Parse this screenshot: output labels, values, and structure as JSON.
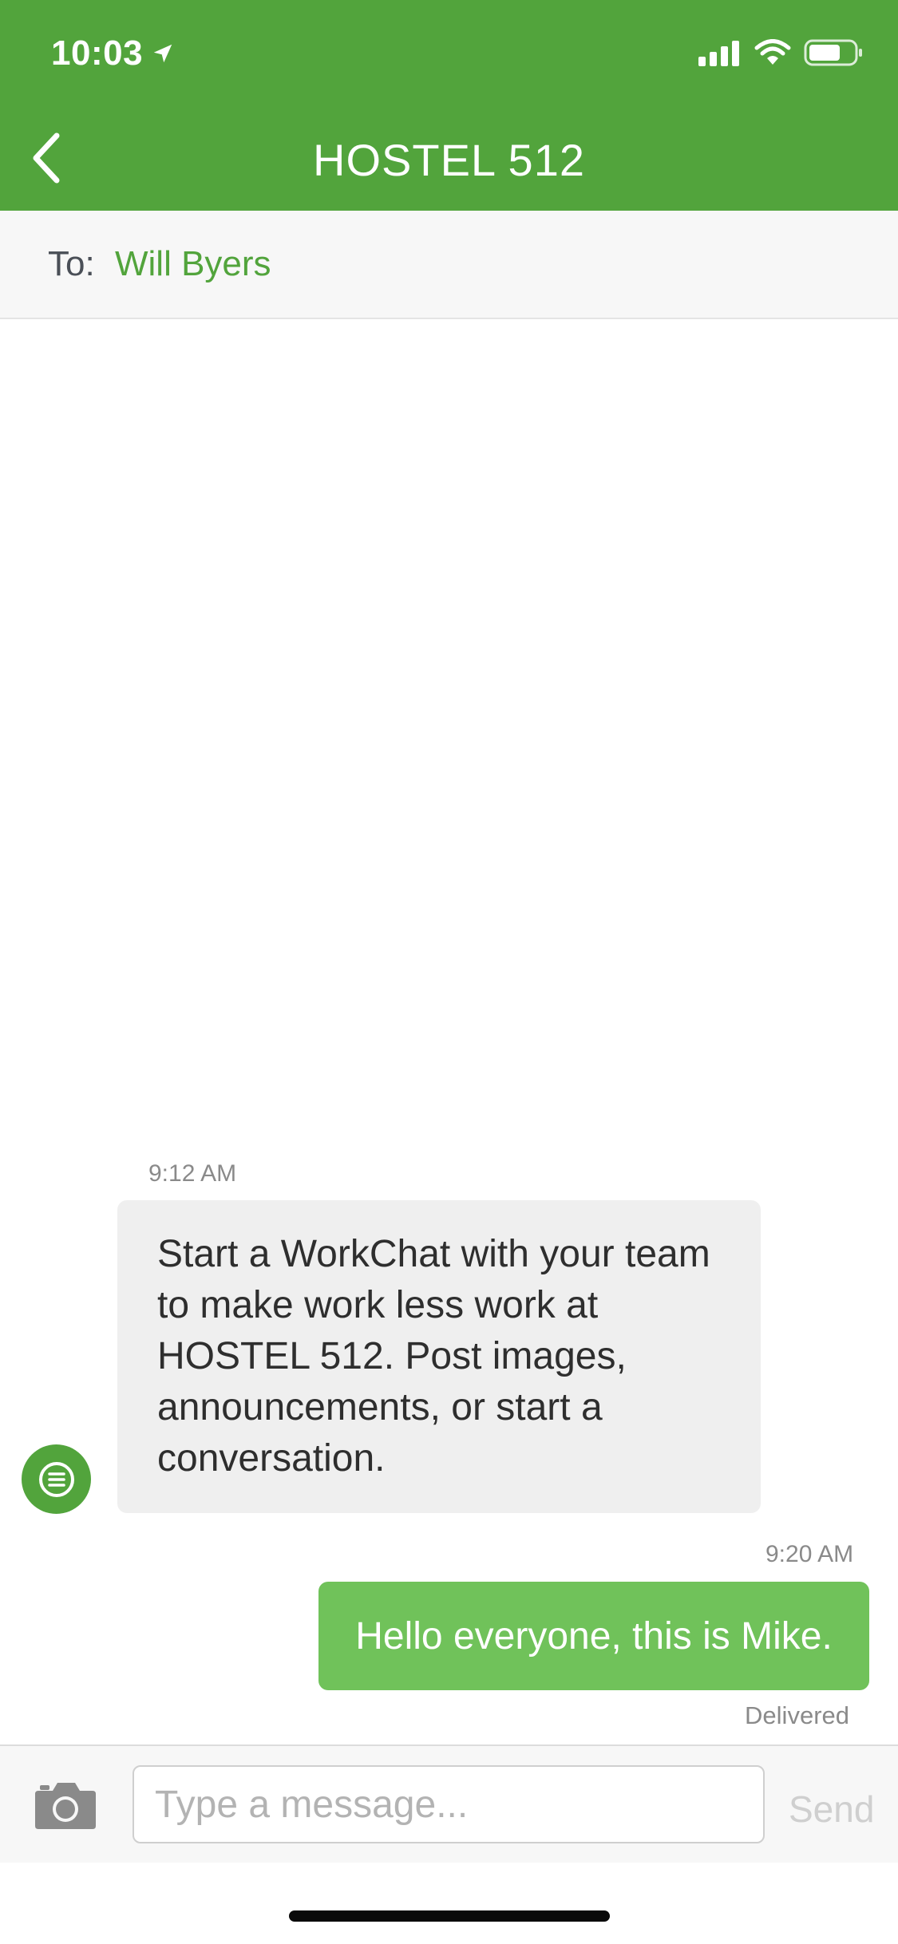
{
  "status": {
    "time": "10:03"
  },
  "header": {
    "title": "HOSTEL 512"
  },
  "recipient": {
    "label": "To:",
    "name": "Will Byers"
  },
  "messages": [
    {
      "time": "9:12 AM",
      "text": "Start a WorkChat with your team to make work less work at HOSTEL 512. Post images, announcements, or start a conversation.",
      "direction": "incoming"
    },
    {
      "time": "9:20 AM",
      "text": "Hello everyone, this is Mike.",
      "direction": "outgoing",
      "status": "Delivered"
    }
  ],
  "composer": {
    "placeholder": "Type a message...",
    "send_label": "Send"
  },
  "colors": {
    "brand": "#52a43c",
    "outgoing_bubble": "#70c25a",
    "incoming_bubble": "#efefef"
  }
}
